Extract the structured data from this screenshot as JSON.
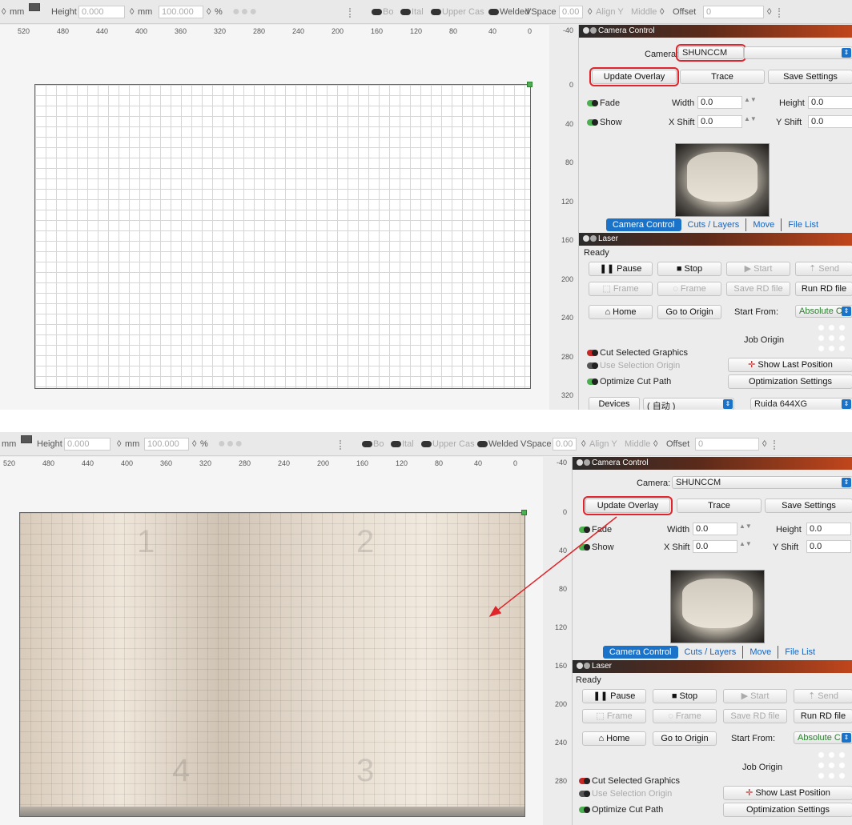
{
  "toolbar": {
    "unit_mm": "mm",
    "height_label": "Height",
    "height_value": "0.000",
    "unit_mm2": "mm",
    "scale_value": "100.000",
    "percent": "%",
    "bold_label": "Bo",
    "italic_label": "Ital",
    "upper_case_label": "Upper Cas",
    "welded_label": "Welded",
    "vspace_label": "VSpace",
    "vspace_value": "0.00",
    "align_y_label": "Align Y",
    "align_y_value": "Middle",
    "offset_label": "Offset",
    "offset_value": "0"
  },
  "ruler": {
    "top_shot1": [
      "520",
      "480",
      "440",
      "400",
      "360",
      "320",
      "280",
      "240",
      "200",
      "160",
      "120",
      "80",
      "40",
      "0",
      "-40"
    ],
    "top_shot2": [
      "520",
      "480",
      "440",
      "400",
      "360",
      "320",
      "280",
      "240",
      "200",
      "160",
      "120",
      "80",
      "40",
      "0",
      "-40"
    ],
    "corner_shot1": "-40",
    "corner_shot2": "-40",
    "left_shot1": [
      "0",
      "40",
      "80",
      "120",
      "160",
      "200",
      "240",
      "280",
      "320"
    ],
    "left_shot2": [
      "0",
      "40",
      "80",
      "120",
      "160",
      "200",
      "240",
      "280"
    ]
  },
  "bed_markers": {
    "m1": "1",
    "m2": "2",
    "m3": "3",
    "m4": "4"
  },
  "camera_panel": {
    "title": "Camera Control",
    "camera_label": "Camera:",
    "camera_value": "SHUNCCM",
    "update_overlay": "Update Overlay",
    "trace": "Trace",
    "save_settings": "Save Settings",
    "fade": "Fade",
    "show": "Show",
    "width_label": "Width",
    "width_value": "0.0",
    "height_label": "Height",
    "height_value": "0.0",
    "xshift_label": "X Shift",
    "xshift_value": "0.0",
    "yshift_label": "Y Shift",
    "yshift_value": "0.0",
    "tabs": [
      "Camera Control",
      "Cuts / Layers",
      "Move",
      "File List"
    ]
  },
  "laser_panel": {
    "title": "Laser",
    "status": "Ready",
    "pause": "Pause",
    "stop": "Stop",
    "start": "Start",
    "send": "Send",
    "frame1": "Frame",
    "frame2": "Frame",
    "save_rd": "Save RD file",
    "run_rd": "Run RD file",
    "home": "Home",
    "go_origin": "Go to Origin",
    "start_from_label": "Start From:",
    "start_from_value": "Absolute C",
    "job_origin": "Job Origin",
    "cut_selected": "Cut Selected Graphics",
    "use_selection_origin": "Use Selection Origin",
    "optimize_cut_path": "Optimize Cut Path",
    "show_last_position": "Show Last Position",
    "optimization_settings": "Optimization Settings",
    "devices": "Devices",
    "device_value": "( 自动 )",
    "controller": "Ruida 644XG"
  },
  "colors": {
    "highlight": "#e0242b",
    "accent": "#1a73c8",
    "toggle_on": "#4caf50"
  }
}
